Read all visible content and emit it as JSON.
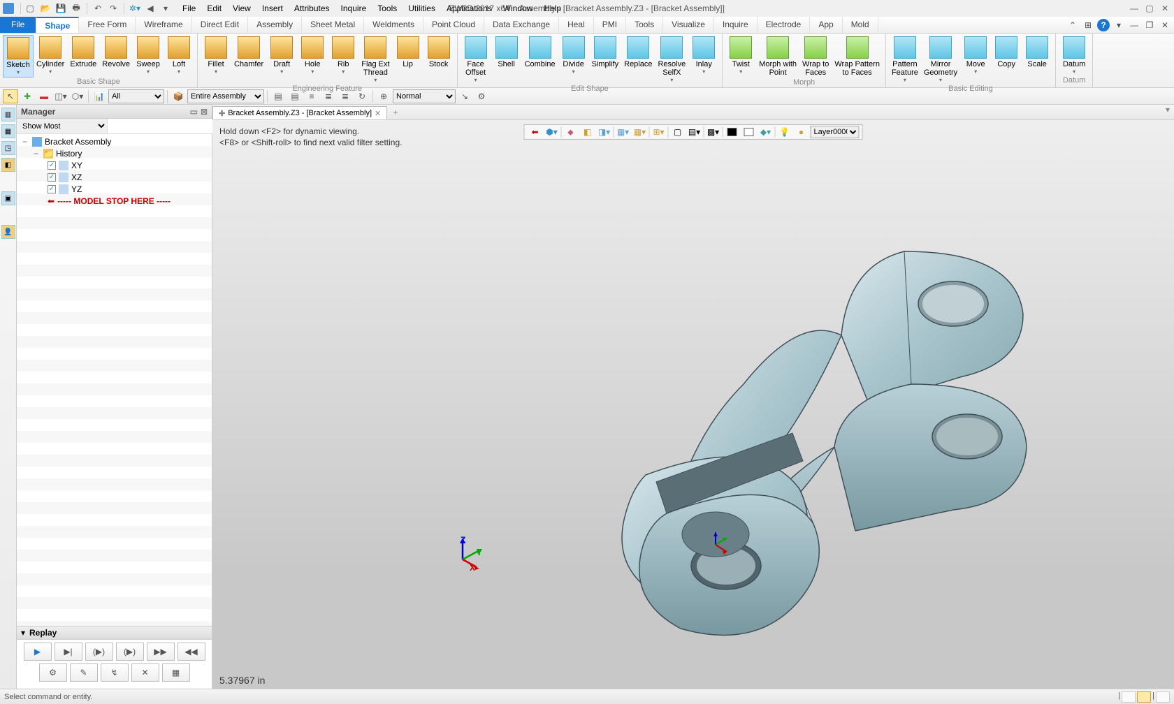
{
  "title": {
    "app": "ZW3D 2017  x64",
    "doc": "Assembly - [Bracket Assembly.Z3 - [Bracket Assembly]]"
  },
  "menus": [
    "File",
    "Edit",
    "View",
    "Insert",
    "Attributes",
    "Inquire",
    "Tools",
    "Utilities",
    "Applications",
    "Window",
    "Help"
  ],
  "tabs": [
    "File",
    "Shape",
    "Free Form",
    "Wireframe",
    "Direct Edit",
    "Assembly",
    "Sheet Metal",
    "Weldments",
    "Point Cloud",
    "Data Exchange",
    "Heal",
    "PMI",
    "Tools",
    "Visualize",
    "Inquire",
    "Electrode",
    "App",
    "Mold"
  ],
  "active_tab": "Shape",
  "ribbon": {
    "g1": {
      "name": "Basic Shape",
      "items": [
        "Sketch",
        "Cylinder",
        "Extrude",
        "Revolve",
        "Sweep",
        "Loft"
      ]
    },
    "g2": {
      "name": "Engineering Feature",
      "items": [
        "Fillet",
        "Chamfer",
        "Draft",
        "Hole",
        "Rib",
        "Flag Ext\nThread",
        "Lip",
        "Stock"
      ]
    },
    "g3": {
      "name": "Edit Shape",
      "items": [
        "Face\nOffset",
        "Shell",
        "Combine",
        "Divide",
        "Simplify",
        "Replace",
        "Resolve\nSelfX",
        "Inlay"
      ]
    },
    "g4": {
      "name": "Morph",
      "items": [
        "Twist",
        "Morph with\nPoint",
        "Wrap to\nFaces",
        "Wrap Pattern\nto Faces"
      ]
    },
    "g5": {
      "name": "Basic Editing",
      "items": [
        "Pattern\nFeature",
        "Mirror\nGeometry",
        "Move",
        "Copy",
        "Scale"
      ]
    },
    "g6": {
      "name": "Datum",
      "items": [
        "Datum"
      ]
    }
  },
  "sectool": {
    "filter": "All",
    "scope": "Entire Assembly",
    "display": "Normal"
  },
  "manager": {
    "title": "Manager",
    "show": "Show Most",
    "root": "Bracket Assembly",
    "history": "History",
    "planes": [
      "XY",
      "XZ",
      "YZ"
    ],
    "stop": "----- MODEL STOP HERE -----"
  },
  "replay": {
    "label": "Replay"
  },
  "doctab": {
    "name": "Bracket Assembly.Z3 - [Bracket Assembly]"
  },
  "hint1": "Hold down <F2> for dynamic viewing.",
  "hint2": "<F8> or <Shift-roll> to find next valid filter setting.",
  "layer": "Layer0000",
  "measure": "5.37967 in",
  "status": "Select command or entity."
}
